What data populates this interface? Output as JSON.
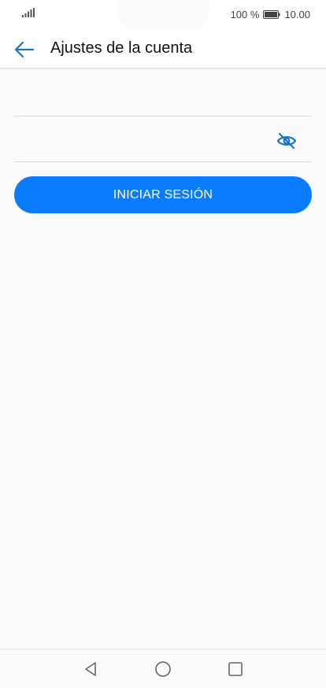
{
  "status_bar": {
    "battery_percent": "100 %",
    "time": "10.00",
    "battery_level": 1.0
  },
  "app_bar": {
    "title": "Ajustes de la cuenta",
    "back_icon": "arrow-left-icon"
  },
  "form": {
    "username": {
      "value": "",
      "placeholder": ""
    },
    "password": {
      "value": "",
      "placeholder": "",
      "toggle_icon": "eye-off-icon"
    },
    "login_label": "INICIAR SESIÓN"
  },
  "nav_bar": {
    "back_icon": "triangle-back-icon",
    "home_icon": "circle-home-icon",
    "recent_icon": "square-recent-icon"
  },
  "colors": {
    "accent": "#0a7cff",
    "icon_blue": "#1a73c8",
    "background": "#fafafa"
  }
}
